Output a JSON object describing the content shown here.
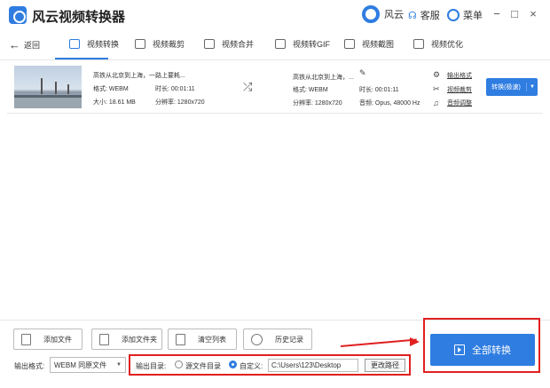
{
  "app": {
    "title": "风云视频转换器"
  },
  "titlebar": {
    "brand_label": "风云",
    "support_label": "客服",
    "menu_label": "菜单",
    "minimize": "−",
    "maximize": "□",
    "close": "×"
  },
  "nav": {
    "back_label": "返回",
    "tabs": [
      {
        "label": "视频转换",
        "icon": "video-convert-icon"
      },
      {
        "label": "视频裁剪",
        "icon": "video-crop-icon"
      },
      {
        "label": "视频合并",
        "icon": "video-merge-icon"
      },
      {
        "label": "视频转GIF",
        "icon": "gif-icon"
      },
      {
        "label": "视频截图",
        "icon": "screenshot-icon"
      },
      {
        "label": "视频优化",
        "icon": "optimize-icon"
      }
    ]
  },
  "file": {
    "source_name": "高铁从北京到上海，一路上要耗...",
    "source_format": "格式: WEBM",
    "source_duration": "时长: 00:01:11",
    "source_size": "大小: 18.61 MB",
    "source_resolution": "分辨率: 1280x720",
    "target_name": "高铁从北京到上海，...",
    "target_format": "格式: WEBM",
    "target_duration": "时长: 00:01:11",
    "target_resolution": "分辨率: 1280x720",
    "target_audio": "音频: Opus, 48000 Hz",
    "options": [
      "输出格式",
      "视频裁剪",
      "音频调整"
    ],
    "convert_label": "转换(极速)"
  },
  "actions": {
    "add_file": "添加文件",
    "add_folder": "添加文件夹",
    "clear_list": "清空列表",
    "history": "历史记录"
  },
  "output": {
    "format_label": "输出格式:",
    "format_value": "WEBM 同原文件",
    "dir_label": "输出目录:",
    "source_dir_label": "源文件目录",
    "custom_label": "自定义:",
    "path_value": "C:\\Users\\123\\Desktop",
    "change_path_label": "更改路径"
  },
  "convert_all_label": "全部转换",
  "colors": {
    "accent": "#2f7de1",
    "highlight": "#e02020"
  }
}
